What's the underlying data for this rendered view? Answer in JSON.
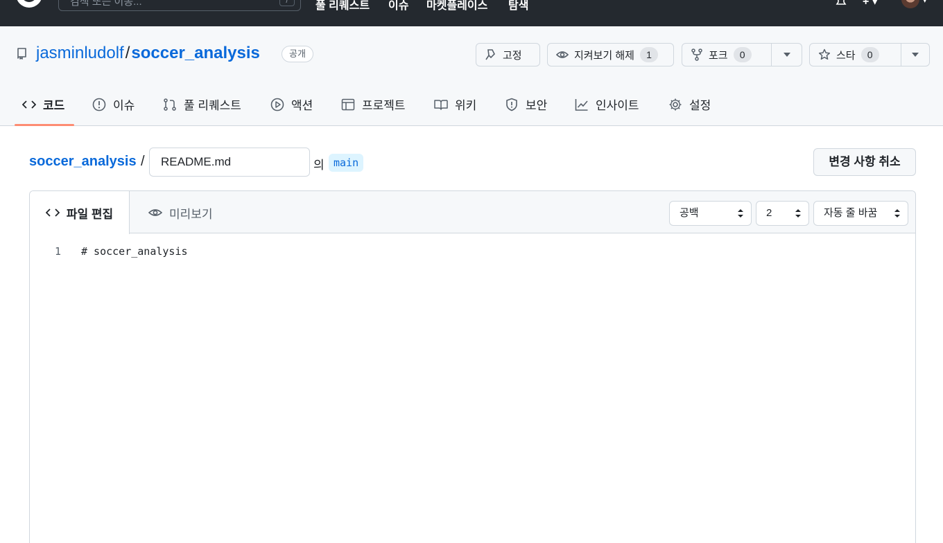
{
  "topbar": {
    "search_placeholder": "검색 또는 이동...",
    "search_shortcut": "/",
    "nav": [
      "풀 리퀘스트",
      "이슈",
      "마켓플레이스",
      "탐색"
    ],
    "icons": [
      "github-logo-icon",
      "bell-icon",
      "plus-icon",
      "avatar"
    ]
  },
  "repo": {
    "owner": "jasminludolf",
    "separator": "/",
    "name": "soccer_analysis",
    "visibility": "공개"
  },
  "actions": {
    "pin_label": "고정",
    "unwatch_label": "지켜보기 해제",
    "unwatch_count": "1",
    "fork_label": "포크",
    "fork_count": "0",
    "star_label": "스타",
    "star_count": "0"
  },
  "tabs": [
    {
      "label": "코드",
      "icon": "code-icon"
    },
    {
      "label": "이슈",
      "icon": "issue-icon"
    },
    {
      "label": "풀 리퀘스트",
      "icon": "pull-request-icon"
    },
    {
      "label": "액션",
      "icon": "play-icon"
    },
    {
      "label": "프로젝트",
      "icon": "table-icon"
    },
    {
      "label": "위키",
      "icon": "book-icon"
    },
    {
      "label": "보안",
      "icon": "shield-icon"
    },
    {
      "label": "인사이트",
      "icon": "graph-icon"
    },
    {
      "label": "설정",
      "icon": "gear-icon"
    }
  ],
  "breadcrumb": {
    "repo": "soccer_analysis",
    "separator": "/",
    "filename": "README.md",
    "in_label": "의",
    "branch": "main",
    "cancel_label": "변경 사항 취소"
  },
  "editor": {
    "edit_tab": "파일 편집",
    "preview_tab": "미리보기",
    "indent_mode": "공백",
    "indent_size": "2",
    "wrap_mode": "자동 줄 바꿈",
    "lines": [
      {
        "number": "1",
        "text": "# soccer_analysis"
      }
    ]
  },
  "colors": {
    "topbar_bg": "#24292f",
    "link": "#0969da",
    "active_tab_underline": "#fd8c73",
    "branch_bg": "#ddf4ff"
  }
}
